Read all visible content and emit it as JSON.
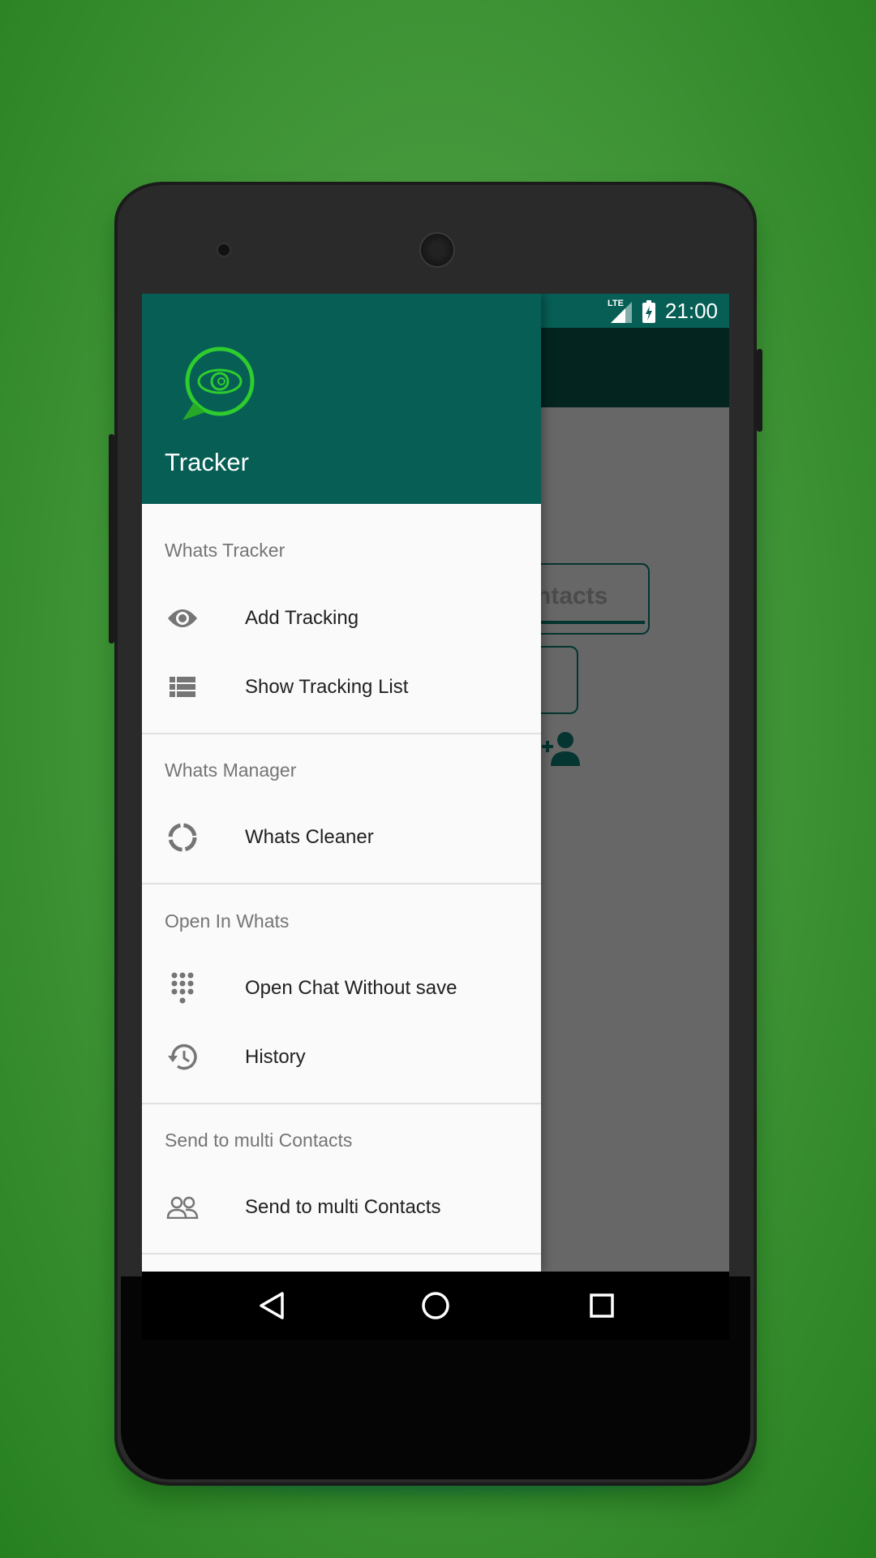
{
  "status_bar": {
    "network": "LTE",
    "time": "21:00"
  },
  "drawer": {
    "app_title": "Tracker",
    "sections": [
      {
        "header": "Whats Tracker",
        "items": [
          {
            "label": "Add Tracking",
            "icon": "eye-icon"
          },
          {
            "label": "Show Tracking List",
            "icon": "list-icon"
          }
        ]
      },
      {
        "header": "Whats Manager",
        "items": [
          {
            "label": "Whats Cleaner",
            "icon": "cleaner-circle-icon"
          }
        ]
      },
      {
        "header": "Open In Whats",
        "items": [
          {
            "label": "Open Chat Without save",
            "icon": "dialpad-icon"
          },
          {
            "label": "History",
            "icon": "history-icon"
          }
        ]
      },
      {
        "header": "Send to multi Contacts",
        "items": [
          {
            "label": "Send to multi Contacts",
            "icon": "people-icon"
          }
        ]
      }
    ]
  },
  "background_screen": {
    "button_text_partial": "ntacts"
  },
  "colors": {
    "primary": "#065e55",
    "primary_dark": "#03241f",
    "logo_green": "#2ecc2e"
  }
}
